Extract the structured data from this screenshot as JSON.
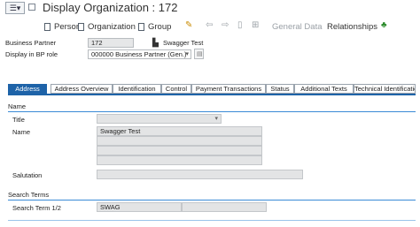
{
  "window": {
    "title": "Display Organization : 172"
  },
  "toolbar": {
    "person": "Person",
    "organization": "Organization",
    "group": "Group",
    "general_data": "General Data",
    "relationships": "Relationships"
  },
  "header": {
    "bp_label": "Business Partner",
    "bp_value": "172",
    "bp_name": "Swagger Test",
    "role_label": "Display in BP role",
    "role_value": "000000 Business Partner (Gen.)"
  },
  "tabs": [
    {
      "label": "Address",
      "active": true
    },
    {
      "label": "Address Overview",
      "active": false
    },
    {
      "label": "Identification",
      "active": false
    },
    {
      "label": "Control",
      "active": false
    },
    {
      "label": "Payment Transactions",
      "active": false
    },
    {
      "label": "Status",
      "active": false
    },
    {
      "label": "Additional Texts",
      "active": false
    },
    {
      "label": "Technical Identification",
      "active": false
    }
  ],
  "name_section": {
    "title": "Name",
    "title_label": "Title",
    "name_label": "Name",
    "name_value": "Swagger Test",
    "salutation_label": "Salutation"
  },
  "search_section": {
    "title": "Search Terms",
    "term_label": "Search Term 1/2",
    "term1_value": "SWAG"
  }
}
